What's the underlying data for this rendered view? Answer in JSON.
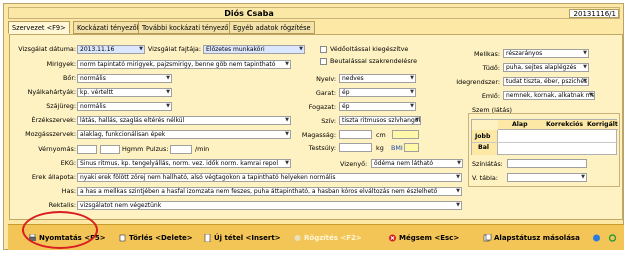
{
  "window": {
    "title": "Diós Csaba",
    "record_id": "20131116/1"
  },
  "tabs": [
    "Szervezet <F9>",
    "Kockázati tényezők",
    "További kockázati tényezők",
    "Egyéb adatok rögzítése"
  ],
  "left": {
    "exam_date_label": "Vizsgálat dátuma:",
    "exam_date": "2013.11.16",
    "exam_type_label": "Vizsgálat fajtája:",
    "exam_type": "Előzetes munkaköri",
    "mirigyek_label": "Mirigyek:",
    "mirigyek": "norm tapintató mirigyek, pajzsmirigy, benne göb nem tapintható",
    "bor_label": "Bőr:",
    "bor": "normális",
    "nyalkahartyak_label": "Nyálkahártyák:",
    "nyalkahartyak": "kp. vérteltt",
    "szajureg_label": "Szájüreg:",
    "szajureg": "normális",
    "erzekszervek_label": "Érzékszervek:",
    "erzekszervek": "látás, hallás, szaglás eltérés nélkül",
    "mozgasszervek_label": "Mozgásszervek:",
    "mozgasszervek": "alaklag, funkcionálisan épek",
    "vernyomas_label": "Vérnyomás:",
    "hgmm": "Hgmm",
    "pulzus_label": "Pulzus:",
    "per_min": "/min",
    "ekg_label": "EKG:",
    "ekg": "Sinus ritmus, kp. tengelyállás, norm. vez. idők norm. kamrai repol",
    "erek_label": "Erek állapota:",
    "erek": "nyaki erek fölött zörej nem hallható, alsó végtagokon a tapintható helyeken normális",
    "has_label": "Has:",
    "has": "a has a mellkas szintjében a hasfal izomzata nem feszes, puha áttapintható, a hasban kóros elváltozás nem észlelhető",
    "rektalis_label": "Rektalis:",
    "rektalis": "vizsgálatot nem végeztünk"
  },
  "mid": {
    "vedo_label": "Védőoltással kiegészítve",
    "beutal_label": "Beutalással szakrendelésre",
    "nyelv_label": "Nyelv:",
    "nyelv": "nedves",
    "garat_label": "Garat:",
    "garat": "ép",
    "fogazat_label": "Fogazat:",
    "fogazat": "ép",
    "szív_label": "Szív:",
    "szív": "tiszta ritmusos szívhangok",
    "magassag_label": "Magasság:",
    "cm": "cm",
    "testsuly_label": "Testsúly:",
    "kg": "kg",
    "bmi": "BMI",
    "vizenyo_label": "Vizenyő:",
    "vizenyo": "ödéma nem látható"
  },
  "right": {
    "mellkas_label": "Mellkas:",
    "mellkas": "részarányos",
    "tudo_label": "Tüdő:",
    "tudo": "puha, sejtes alaplégzés",
    "idegrendszer_label": "Idegrendszer:",
    "idegrendszer": "tudat tiszta, éber, pszichés",
    "emlo_label": "Emlő:",
    "emlo": "nemnek, kornak, alkatnak megfelelő",
    "szem_label": "Szem (látás)",
    "grid_cols": [
      "Alap",
      "Korrekciós",
      "Korrigált"
    ],
    "grid_rows": [
      "Jobb",
      "Bal"
    ],
    "szinlatas_label": "Színlátás:",
    "vtabla_label": "V. tábla:"
  },
  "toolbar": {
    "print": "Nyomtatás <F5>",
    "delete": "Törlés <Delete>",
    "new": "Új tétel <Insert>",
    "save": "Rögzítés <F2>",
    "cancel": "Mégsem <Esc>",
    "reset": "Alapstátusz másolása"
  }
}
